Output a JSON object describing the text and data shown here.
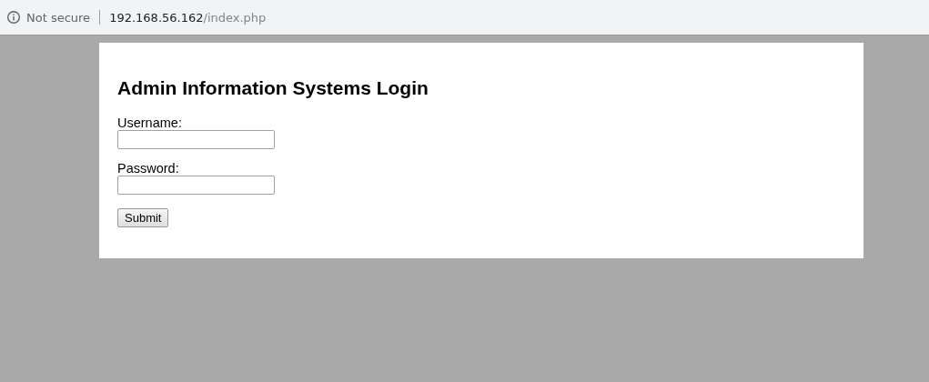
{
  "address_bar": {
    "security": "Not secure",
    "host": "192.168.56.162",
    "path": "/index.php"
  },
  "login_form": {
    "title": "Admin Information Systems Login",
    "fields": [
      {
        "label": "Username:"
      },
      {
        "label": "Password:"
      }
    ],
    "submit": "Submit"
  }
}
